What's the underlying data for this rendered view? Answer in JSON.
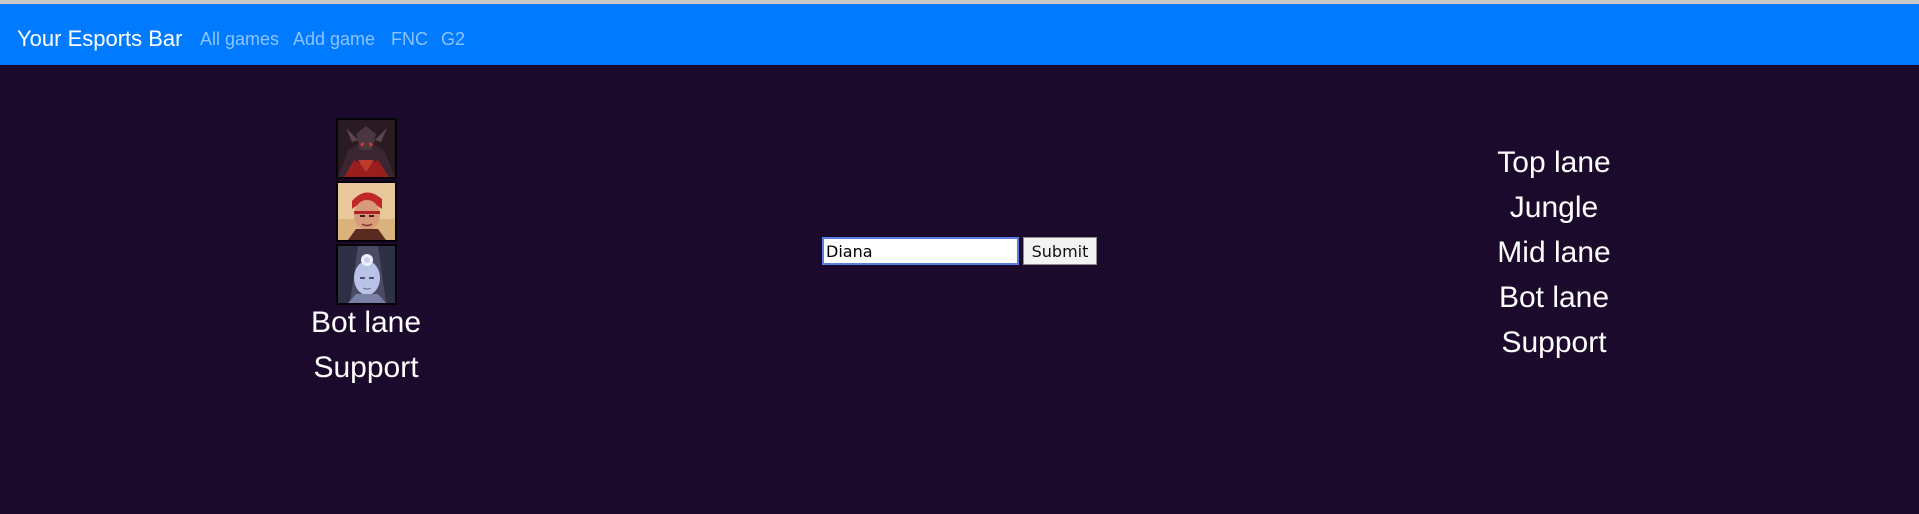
{
  "navbar": {
    "brand": "Your Esports Bar",
    "links": [
      "All games",
      "Add game",
      "FNC",
      "G2"
    ],
    "background": "#007bff"
  },
  "left_panel": {
    "champions": [
      {
        "name": "dark-armored-champion-portrait",
        "accent": "#c0392b"
      },
      {
        "name": "red-haired-champion-portrait",
        "accent": "#e8c89a"
      },
      {
        "name": "moon-champion-portrait",
        "accent": "#b9c3e6"
      }
    ],
    "assigned_roles": [
      "Bot lane",
      "Support"
    ]
  },
  "search": {
    "value": "Diana",
    "submit_label": "Submit"
  },
  "roles": [
    "Top lane",
    "Jungle",
    "Mid lane",
    "Bot lane",
    "Support"
  ],
  "colors": {
    "page_background": "#1b0a2c",
    "text": "#ffffff"
  }
}
